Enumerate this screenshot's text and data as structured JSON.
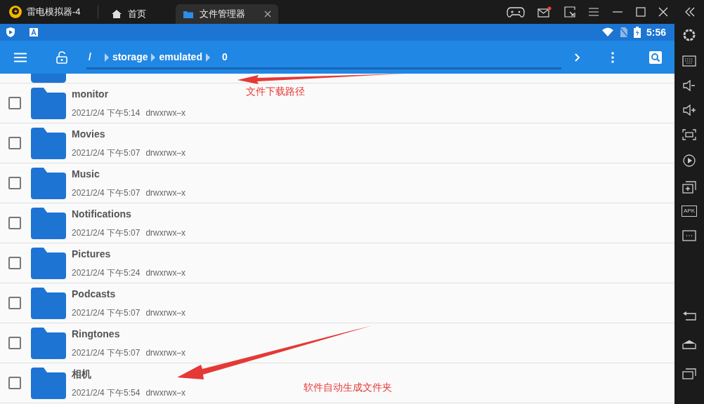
{
  "window": {
    "title": "雷电模拟器-4"
  },
  "tabs": [
    {
      "label": "首页",
      "kind": "home",
      "selected": false
    },
    {
      "label": "文件管理器",
      "kind": "files",
      "selected": true
    }
  ],
  "status_bar": {
    "time": "5:56"
  },
  "toolbar": {
    "path": [
      "/",
      "storage",
      "emulated",
      "0"
    ]
  },
  "files": [
    {
      "name": "monitor",
      "date": "2021/2/4 下午5:14",
      "permissions": "drwxrwx–x",
      "checked": false
    },
    {
      "name": "Movies",
      "date": "2021/2/4 下午5:07",
      "permissions": "drwxrwx–x",
      "checked": false
    },
    {
      "name": "Music",
      "date": "2021/2/4 下午5:07",
      "permissions": "drwxrwx–x",
      "checked": false
    },
    {
      "name": "Notifications",
      "date": "2021/2/4 下午5:07",
      "permissions": "drwxrwx–x",
      "checked": false
    },
    {
      "name": "Pictures",
      "date": "2021/2/4 下午5:24",
      "permissions": "drwxrwx–x",
      "checked": false
    },
    {
      "name": "Podcasts",
      "date": "2021/2/4 下午5:07",
      "permissions": "drwxrwx–x",
      "checked": false
    },
    {
      "name": "Ringtones",
      "date": "2021/2/4 下午5:07",
      "permissions": "drwxrwx–x",
      "checked": false
    },
    {
      "name": "相机",
      "date": "2021/2/4 下午5:54",
      "permissions": "drwxrwx–x",
      "checked": false
    }
  ],
  "annotations": [
    {
      "text": "文件下载路径"
    },
    {
      "text": "软件自动生成文件夹"
    }
  ],
  "sidebar": {
    "apk_label": "APK"
  }
}
